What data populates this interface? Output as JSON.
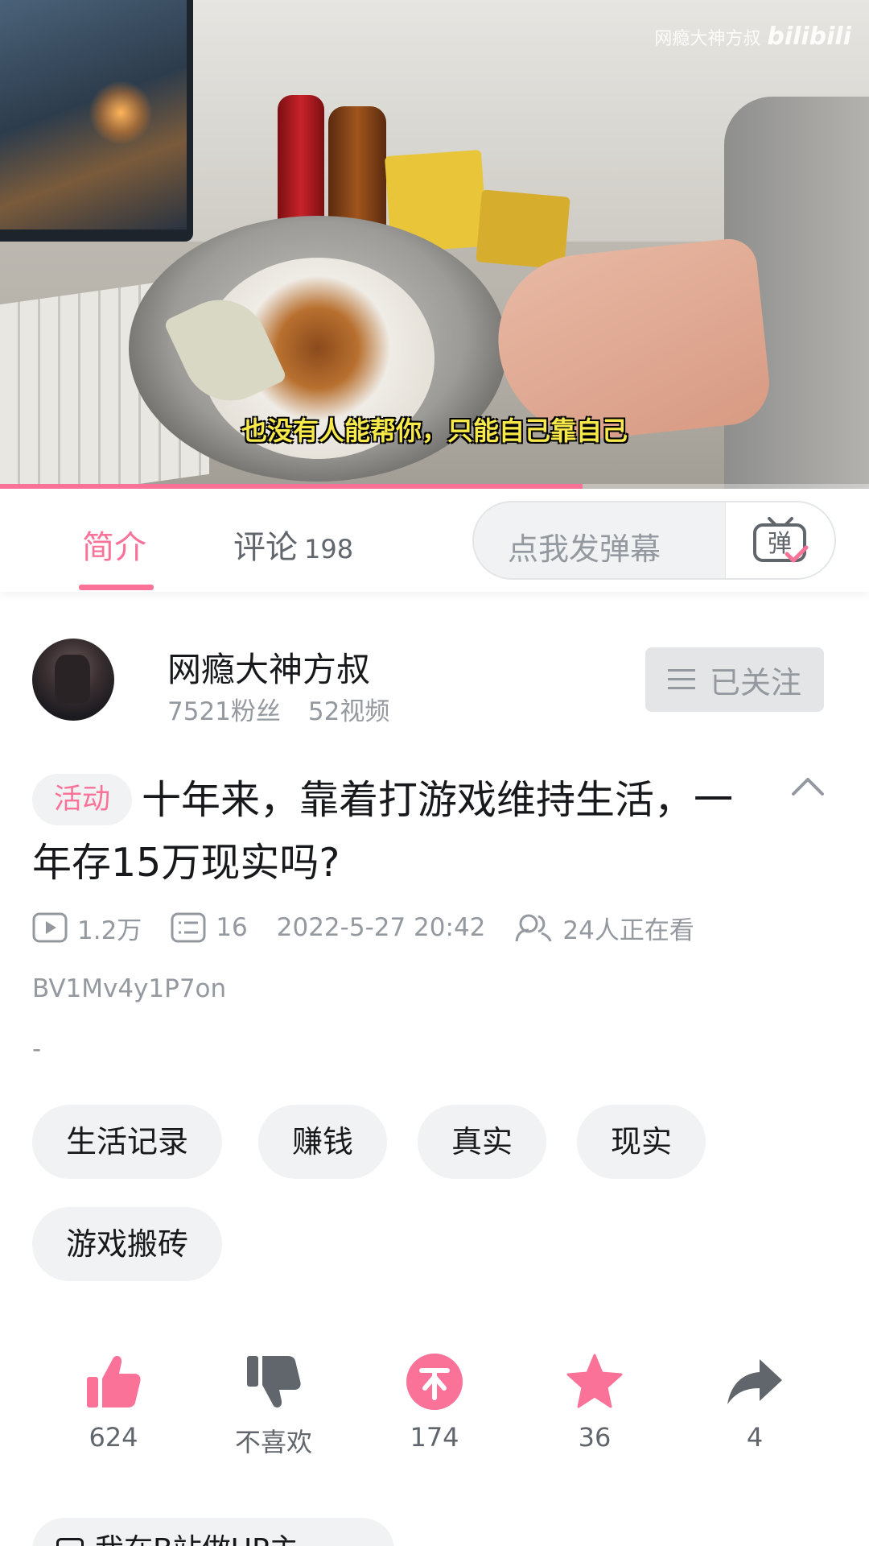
{
  "video": {
    "watermark_channel": "网瘾大神方叔",
    "watermark_logo": "bilibili",
    "subtitle": "也没有人能帮你，只能自己靠自己",
    "progress_fraction": 0.67
  },
  "tabs": {
    "intro_label": "简介",
    "comments_label": "评论",
    "comments_count": "198"
  },
  "danmaku": {
    "placeholder": "点我发弹幕",
    "button_glyph": "弹"
  },
  "uploader": {
    "name": "网瘾大神方叔",
    "fans": "7521粉丝",
    "videos": "52视频",
    "follow_label": "已关注"
  },
  "video_info": {
    "badge": "活动",
    "title": "十年来，靠着打游戏维持生活，一年存15万现实吗?",
    "views": "1.2万",
    "danmaku_count": "16",
    "date": "2022-5-27 20:42",
    "watching": "24人正在看",
    "bvid": "BV1Mv4y1P7on",
    "description": "-"
  },
  "tags": [
    "生活记录",
    "赚钱",
    "真实",
    "现实",
    "游戏搬砖"
  ],
  "actions": {
    "like": "624",
    "dislike": "不喜欢",
    "coin": "174",
    "favorite": "36",
    "share": "4"
  },
  "bottom_chip": "我在B站做UP主",
  "colors": {
    "accent": "#fb7299",
    "text_primary": "#18191c",
    "text_secondary": "#9499a0",
    "chip_bg": "#f1f2f3",
    "icon_dark": "#61666d"
  }
}
